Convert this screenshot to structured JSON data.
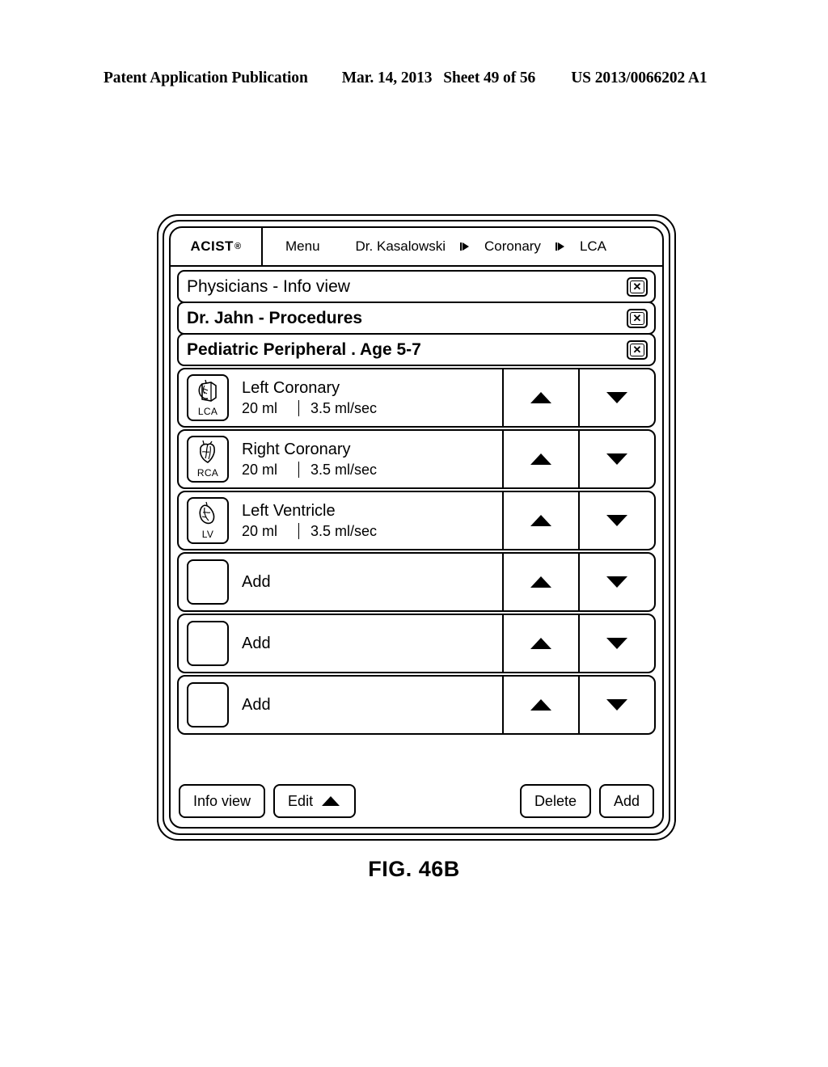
{
  "publication_header": {
    "left": "Patent Application Publication",
    "date": "Mar. 14, 2013",
    "sheet": "Sheet 49 of 56",
    "patent_number": "US 2013/0066202 A1"
  },
  "figure_caption": "FIG. 46B",
  "device": {
    "topbar": {
      "brand": "ACIST",
      "brand_mark": "®",
      "menu_label": "Menu",
      "breadcrumb": [
        {
          "label": "Dr. Kasalowski",
          "separator_icon": "triangle-right-icon"
        },
        {
          "label": "Coronary",
          "separator_icon": "triangle-right-icon"
        },
        {
          "label": "LCA",
          "separator_icon": null
        }
      ]
    },
    "title_bars": [
      {
        "text": "Physicians - Info view",
        "bold": false,
        "close_icon": "close-x-icon"
      },
      {
        "text": "Dr. Jahn - Procedures",
        "bold": true,
        "close_icon": "close-x-icon"
      },
      {
        "text": "Pediatric Peripheral . Age 5-7",
        "bold": true,
        "close_icon": "close-x-icon"
      }
    ],
    "rows": [
      {
        "icon": "heart-lca-icon",
        "icon_label": "LCA",
        "title": "Left Coronary",
        "volume": "20 ml",
        "rate": "3.5 ml/sec",
        "up_icon": "triangle-up-icon",
        "down_icon": "triangle-down-icon"
      },
      {
        "icon": "heart-rca-icon",
        "icon_label": "RCA",
        "title": "Right Coronary",
        "volume": "20 ml",
        "rate": "3.5 ml/sec",
        "up_icon": "triangle-up-icon",
        "down_icon": "triangle-down-icon"
      },
      {
        "icon": "heart-lv-icon",
        "icon_label": "LV",
        "title": "Left Ventricle",
        "volume": "20 ml",
        "rate": "3.5 ml/sec",
        "up_icon": "triangle-up-icon",
        "down_icon": "triangle-down-icon"
      },
      {
        "icon": null,
        "icon_label": "",
        "title": "Add",
        "volume": "",
        "rate": "",
        "up_icon": "triangle-up-icon",
        "down_icon": "triangle-down-icon"
      },
      {
        "icon": null,
        "icon_label": "",
        "title": "Add",
        "volume": "",
        "rate": "",
        "up_icon": "triangle-up-icon",
        "down_icon": "triangle-down-icon"
      },
      {
        "icon": null,
        "icon_label": "",
        "title": "Add",
        "volume": "",
        "rate": "",
        "up_icon": "triangle-up-icon",
        "down_icon": "triangle-down-icon"
      }
    ],
    "toolbar": {
      "info_view_label": "Info view",
      "edit_label": "Edit",
      "edit_icon": "triangle-up-icon",
      "delete_label": "Delete",
      "add_label": "Add"
    }
  }
}
